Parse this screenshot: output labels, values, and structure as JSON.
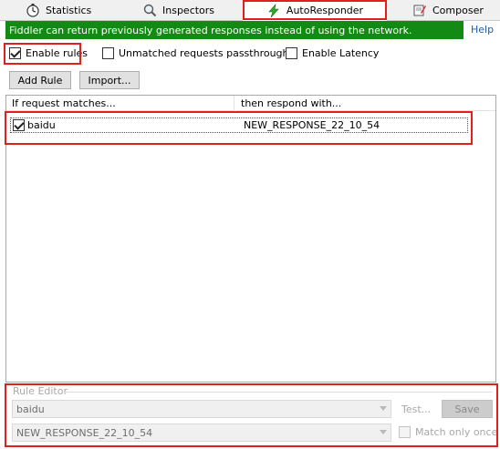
{
  "tabs": [
    {
      "label": "Statistics",
      "icon": "stopwatch-icon"
    },
    {
      "label": "Inspectors",
      "icon": "magnifier-icon"
    },
    {
      "label": "AutoResponder",
      "icon": "lightning-icon"
    },
    {
      "label": "Composer",
      "icon": "composer-icon"
    }
  ],
  "banner": {
    "text": "Fiddler can return previously generated responses instead of using the network.",
    "color": "#138a13"
  },
  "help_link": "Help",
  "options": {
    "enable_rules": {
      "label": "Enable rules",
      "checked": true
    },
    "unmatched": {
      "label": "Unmatched requests passthrough",
      "checked": false
    },
    "latency": {
      "label": "Enable Latency",
      "checked": false
    }
  },
  "toolbar": {
    "add_rule": "Add Rule",
    "import": "Import..."
  },
  "rules_list": {
    "columns": [
      "If request matches...",
      "then respond with..."
    ],
    "rows": [
      {
        "checked": true,
        "match": "baidu",
        "response": "NEW_RESPONSE_22_10_54"
      }
    ]
  },
  "rule_editor": {
    "title": "Rule Editor",
    "match_value": "baidu",
    "response_value": "NEW_RESPONSE_22_10_54",
    "test_label": "Test...",
    "save_label": "Save",
    "match_only_once": {
      "label": "Match only once",
      "checked": false
    }
  },
  "highlight_color": "#e0201c"
}
